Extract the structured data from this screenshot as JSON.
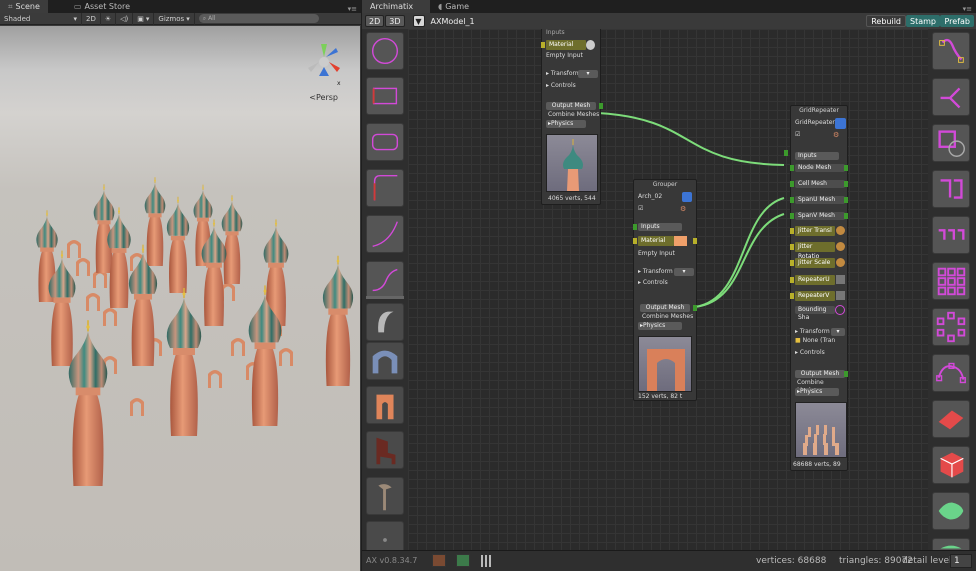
{
  "scene_tabs": {
    "scene": "Scene",
    "asset_store": "Asset Store"
  },
  "scene_toolbar": {
    "shading": "Shaded",
    "mode_2d": "2D",
    "gizmos": "Gizmos",
    "search_placeholder": "All"
  },
  "viewport": {
    "persp_label": "Persp",
    "axis_label": "x"
  },
  "ax_tabs": {
    "archimatix": "Archimatix",
    "game": "Game"
  },
  "ax_toolbar": {
    "btn_2d": "2D",
    "btn_3d": "3D",
    "model_name": "AXModel_1",
    "rebuild": "Rebuild",
    "stamp": "Stamp",
    "prefab": "Prefab"
  },
  "node_top": {
    "inputs": "Inputs",
    "material": "Material",
    "empty_input": "Empty Input",
    "transform": "Transform",
    "controls": "Controls",
    "output_mesh": "Output Mesh",
    "combine_meshes": "Combine Meshes",
    "physics": "Physics",
    "verts": "4065 verts, 544"
  },
  "node_grouper": {
    "title": "Grouper",
    "name": "Arch_02",
    "inputs": "Inputs",
    "material": "Material",
    "empty_input": "Empty Input",
    "transform": "Transform",
    "controls": "Controls",
    "output_mesh": "Output Mesh",
    "combine_meshes": "Combine Meshes",
    "physics": "Physics",
    "verts": "152 verts, 82 t"
  },
  "node_grid": {
    "title": "GridRepeater",
    "name": "GridRepeater",
    "inputs": "Inputs",
    "node_mesh": "Node Mesh",
    "cell_mesh": "Cell Mesh",
    "span_u_mesh": "SpanU Mesh",
    "span_v_mesh": "SpanV Mesh",
    "jitter_translation": "Jitter Transl",
    "jitter_rotation": "Jitter Rotatio",
    "jitter_scale": "Jitter Scale",
    "repeater_u": "RepeaterU",
    "repeater_v": "RepeaterV",
    "bounding_shape": "Bounding Sha",
    "transform": "Transform",
    "none_from": "None (Tran",
    "controls": "Controls",
    "output_mesh": "Output Mesh",
    "combine_meshes": "Combine Meshes",
    "physics": "Physics",
    "verts": "68688 verts, 89"
  },
  "status": {
    "version": "AX v0.8.34.7",
    "vertices": "vertices: 68688",
    "triangles": "triangles: 89072",
    "detail_label": "detail level",
    "detail_value": "1"
  },
  "colors": {
    "accent_teal": "#2d6e6a",
    "wire": "#7ddc7a",
    "olive": "#6e6e2c",
    "magenta_icon": "#d24ad8"
  }
}
